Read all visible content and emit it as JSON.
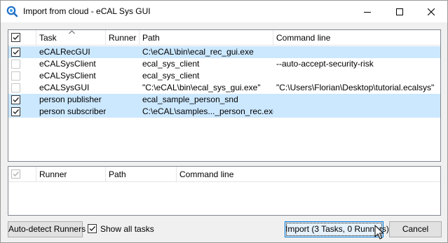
{
  "window": {
    "title": "Import from cloud - eCAL Sys GUI",
    "accent_color": "#0078d7",
    "selected_row_color": "#cce8ff"
  },
  "tasks_table": {
    "columns": {
      "task": "Task",
      "runner": "Runner",
      "path": "Path",
      "command_line": "Command line"
    },
    "header_checked": true,
    "sort_indicator": "chevron-up-icon",
    "rows": [
      {
        "checked": true,
        "selected": true,
        "task": "eCALRecGUI",
        "runner": "",
        "path": "C:\\eCAL\\bin\\ecal_rec_gui.exe",
        "command_line": ""
      },
      {
        "checked": false,
        "selected": false,
        "task": "eCALSysClient",
        "runner": "",
        "path": "ecal_sys_client",
        "command_line": "--auto-accept-security-risk"
      },
      {
        "checked": false,
        "selected": false,
        "task": "eCALSysClient",
        "runner": "",
        "path": "ecal_sys_client",
        "command_line": ""
      },
      {
        "checked": false,
        "selected": false,
        "task": "eCALSysGUI",
        "runner": "",
        "path": "\"C:\\eCAL\\bin\\ecal_sys_gui.exe\"",
        "command_line": "\"C:\\Users\\Florian\\Desktop\\tutorial.ecalsys\""
      },
      {
        "checked": true,
        "selected": true,
        "task": "person publisher",
        "runner": "",
        "path": "ecal_sample_person_snd",
        "command_line": ""
      },
      {
        "checked": true,
        "selected": true,
        "task": "person subscriber",
        "runner": "",
        "path": "C:\\eCAL\\samples..._person_rec.exe",
        "command_line": ""
      }
    ],
    "scrollbar": {
      "left_arrow": "chevron-left-icon",
      "right_arrow": "chevron-right-icon"
    }
  },
  "runners_table": {
    "columns": {
      "runner": "Runner",
      "path": "Path",
      "command_line": "Command line"
    },
    "header_checked": true
  },
  "footer": {
    "autodetect_label": "Auto-detect Runners",
    "show_all_label": "Show all tasks",
    "show_all_checked": true,
    "import_label": "Import (3 Tasks, 0 Runners)",
    "cancel_label": "Cancel"
  }
}
